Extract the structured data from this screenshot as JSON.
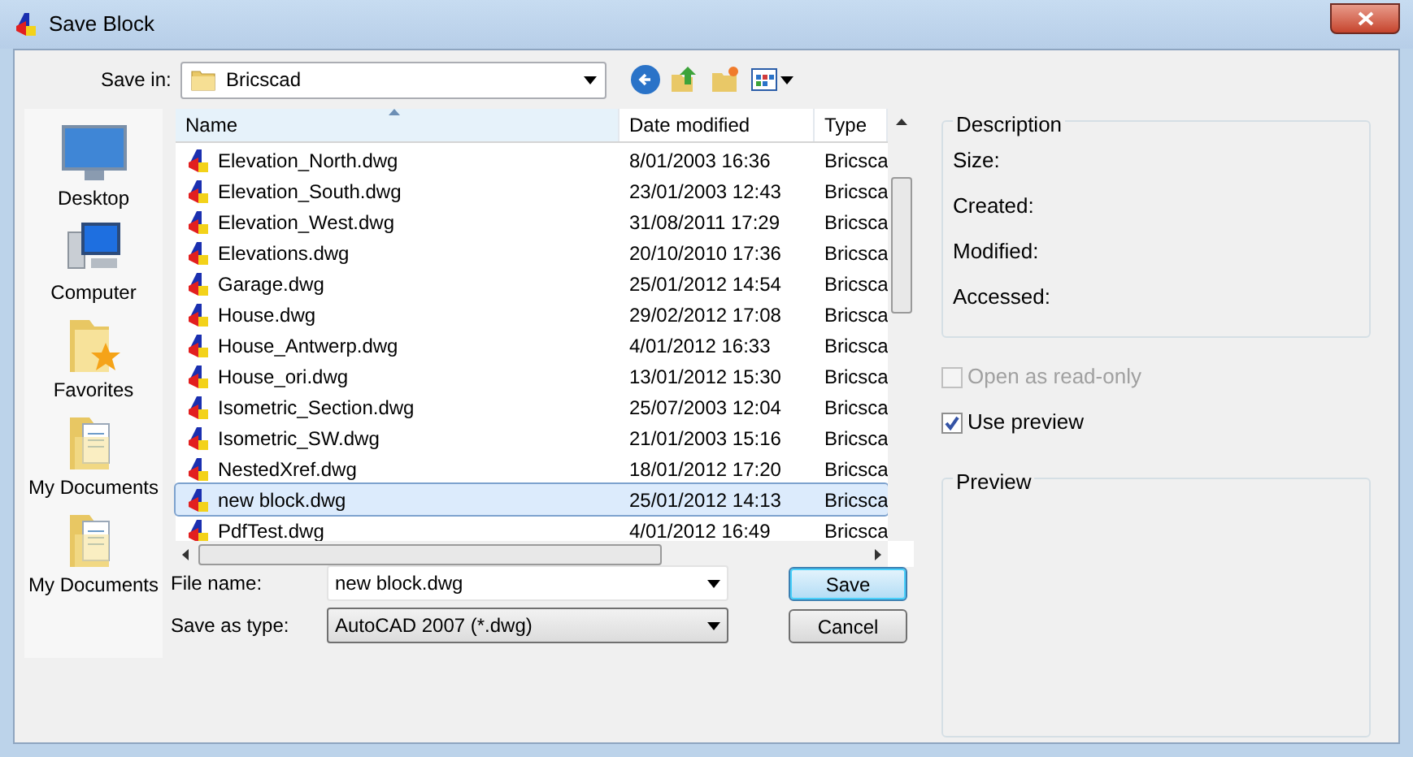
{
  "window": {
    "title": "Save Block"
  },
  "save_in": {
    "label": "Save in:",
    "value": "Bricscad"
  },
  "places": [
    {
      "label": "Desktop",
      "kind": "desktop"
    },
    {
      "label": "Computer",
      "kind": "computer"
    },
    {
      "label": "Favorites",
      "kind": "favorites"
    },
    {
      "label": "My Documents",
      "kind": "documents"
    },
    {
      "label": "My Documents",
      "kind": "documents"
    }
  ],
  "file_list": {
    "columns": [
      "Name",
      "Date modified",
      "Type"
    ],
    "rows": [
      {
        "name": "Elevation_North.dwg",
        "date": "8/01/2003 16:36",
        "type": "Bricsca",
        "selected": false
      },
      {
        "name": "Elevation_South.dwg",
        "date": "23/01/2003 12:43",
        "type": "Bricsca",
        "selected": false
      },
      {
        "name": "Elevation_West.dwg",
        "date": "31/08/2011 17:29",
        "type": "Bricsca",
        "selected": false
      },
      {
        "name": "Elevations.dwg",
        "date": "20/10/2010 17:36",
        "type": "Bricsca",
        "selected": false
      },
      {
        "name": "Garage.dwg",
        "date": "25/01/2012 14:54",
        "type": "Bricsca",
        "selected": false
      },
      {
        "name": "House.dwg",
        "date": "29/02/2012 17:08",
        "type": "Bricsca",
        "selected": false
      },
      {
        "name": "House_Antwerp.dwg",
        "date": "4/01/2012 16:33",
        "type": "Bricsca",
        "selected": false
      },
      {
        "name": "House_ori.dwg",
        "date": "13/01/2012 15:30",
        "type": "Bricsca",
        "selected": false
      },
      {
        "name": "Isometric_Section.dwg",
        "date": "25/07/2003 12:04",
        "type": "Bricsca",
        "selected": false
      },
      {
        "name": "Isometric_SW.dwg",
        "date": "21/01/2003 15:16",
        "type": "Bricsca",
        "selected": false
      },
      {
        "name": "NestedXref.dwg",
        "date": "18/01/2012 17:20",
        "type": "Bricsca",
        "selected": false
      },
      {
        "name": "new block.dwg",
        "date": "25/01/2012 14:13",
        "type": "Bricsca",
        "selected": true
      },
      {
        "name": "PdfTest.dwg",
        "date": "4/01/2012 16:49",
        "type": "Bricsca",
        "selected": false
      }
    ]
  },
  "file_name": {
    "label": "File name:",
    "value": "new block.dwg"
  },
  "save_as_type": {
    "label": "Save as type:",
    "value": "AutoCAD 2007 (*.dwg)"
  },
  "buttons": [
    {
      "label": "Save",
      "kind": "default"
    },
    {
      "label": "Cancel",
      "kind": "normal"
    }
  ],
  "description": {
    "title": "Description",
    "fields": [
      "Size:",
      "Created:",
      "Modified:",
      "Accessed:"
    ]
  },
  "options": [
    {
      "label": "Open as read-only",
      "checked": false,
      "disabled": true
    },
    {
      "label": "Use preview",
      "checked": true,
      "disabled": false
    }
  ],
  "preview": {
    "title": "Preview"
  }
}
